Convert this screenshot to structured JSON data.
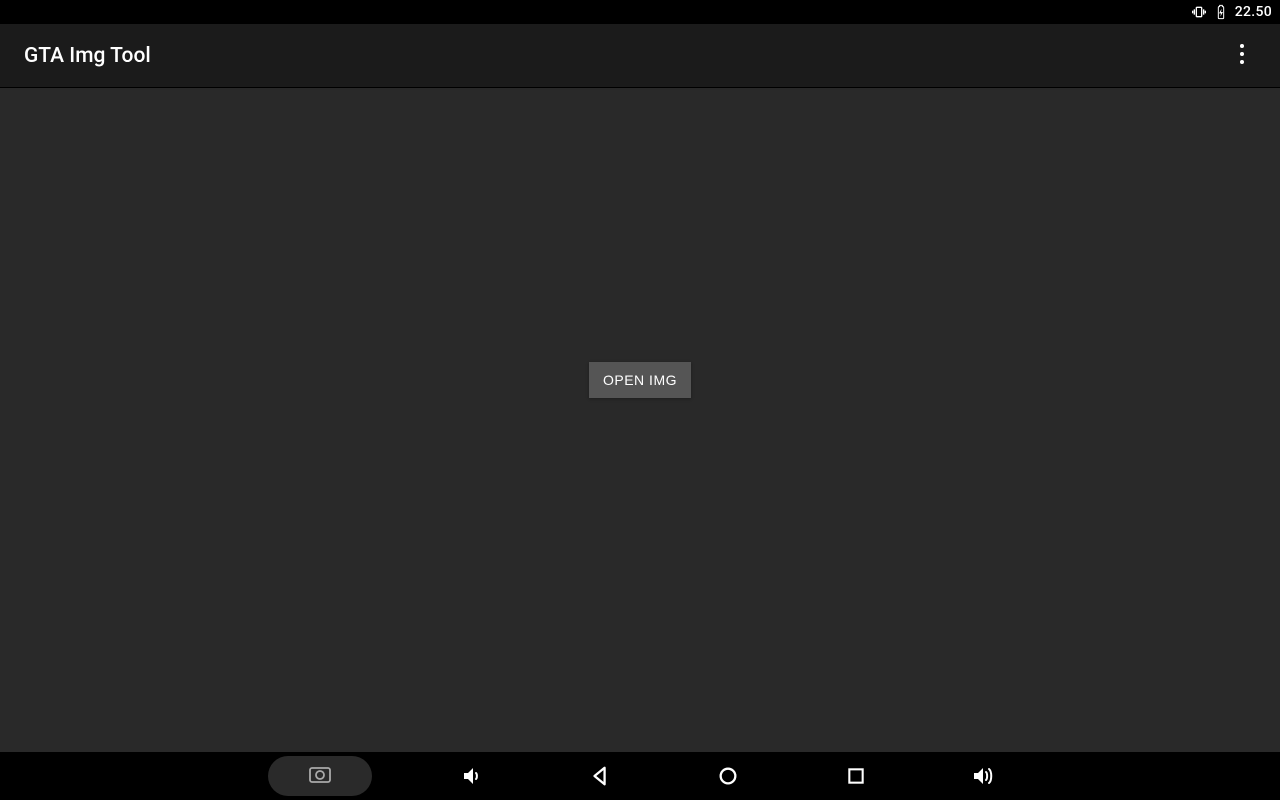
{
  "status": {
    "time": "22.50"
  },
  "app": {
    "title": "GTA Img Tool"
  },
  "main": {
    "open_button_label": "OPEN IMG"
  },
  "colors": {
    "status_bg": "#000000",
    "appbar_bg": "#1b1b1b",
    "content_bg": "#292929",
    "button_bg": "#555555",
    "text": "#ffffff"
  }
}
